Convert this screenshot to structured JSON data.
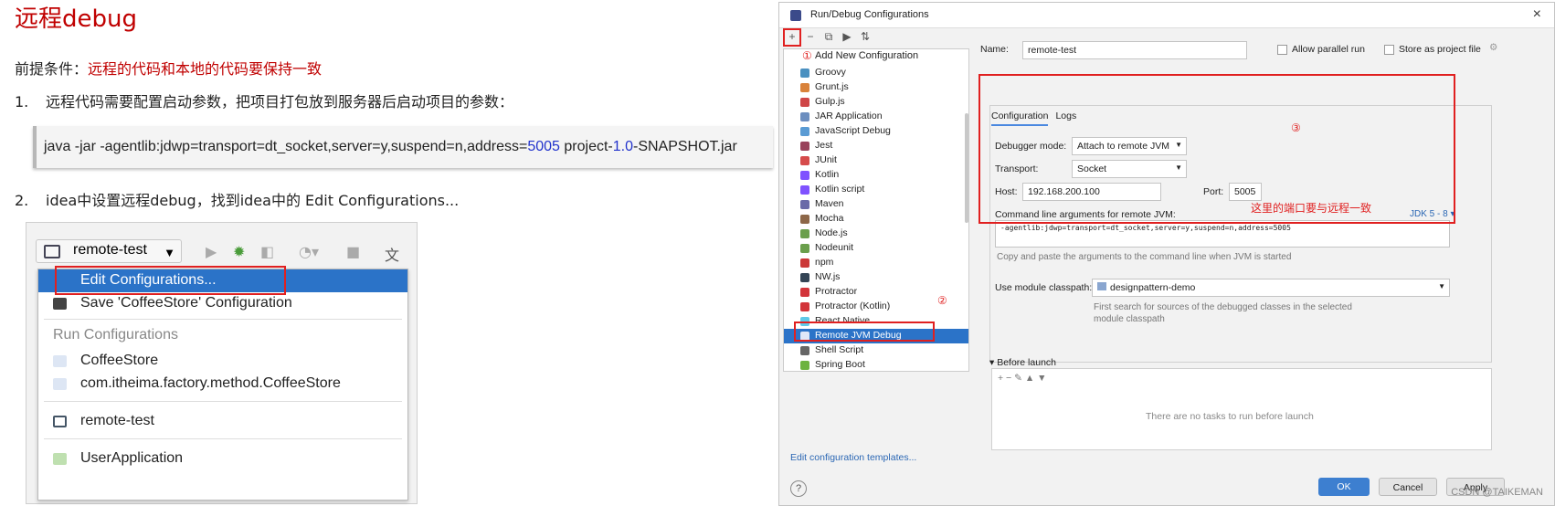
{
  "slide": {
    "title": "远程debug",
    "pre_label": "前提条件：",
    "pre_text": "远程的代码和本地的代码要保持一致",
    "step1_num": "1.",
    "step1_text": "远程代码需要配置启动参数，把项目打包放到服务器后启动项目的参数：",
    "code_a": "java -jar -agentlib:jdwp=transport=dt_socket,server=y,suspend=n,address=",
    "code_port": "5005",
    "code_b": " project-",
    "code_ver": "1.0",
    "code_c": "-SNAPSHOT.jar",
    "step2_num": "2.",
    "step2_text": "idea中设置远程debug，找到idea中的 Edit Configurations..."
  },
  "idea": {
    "run_config": "remote-test",
    "menu": {
      "edit": "Edit Configurations...",
      "save": "Save 'CoffeeStore' Configuration",
      "header": "Run Configurations",
      "items": [
        "CoffeeStore",
        "com.itheima.factory.method.CoffeeStore"
      ],
      "remote": "remote-test",
      "user_app": "UserApplication"
    }
  },
  "dialog": {
    "title": "Run/Debug Configurations",
    "close": "×",
    "toolbar": [
      "+",
      "−",
      "⧉",
      "▶",
      "⇅"
    ],
    "add_new": "Add New Configuration",
    "ann1": "①",
    "ann2": "②",
    "ann3": "③",
    "ann_text": "这里的端口要与远程一致",
    "templates": [
      {
        "label": "Groovy",
        "color": "#4a90c0"
      },
      {
        "label": "Grunt.js",
        "color": "#d9823a"
      },
      {
        "label": "Gulp.js",
        "color": "#cf4647"
      },
      {
        "label": "JAR Application",
        "color": "#6c8ebf"
      },
      {
        "label": "JavaScript Debug",
        "color": "#5a9bd4"
      },
      {
        "label": "Jest",
        "color": "#99425b"
      },
      {
        "label": "JUnit",
        "color": "#d64b4b"
      },
      {
        "label": "Kotlin",
        "color": "#7f52ff"
      },
      {
        "label": "Kotlin script",
        "color": "#7f52ff"
      },
      {
        "label": "Maven",
        "color": "#6a6aa8"
      },
      {
        "label": "Mocha",
        "color": "#8d6748"
      },
      {
        "label": "Node.js",
        "color": "#6a9f4c"
      },
      {
        "label": "Nodeunit",
        "color": "#6a9f4c"
      },
      {
        "label": "npm",
        "color": "#cb3837"
      },
      {
        "label": "NW.js",
        "color": "#334455"
      },
      {
        "label": "Protractor",
        "color": "#d2343a"
      },
      {
        "label": "Protractor (Kotlin)",
        "color": "#d2343a"
      },
      {
        "label": "React Native",
        "color": "#5fc9e8"
      },
      {
        "label": "Remote JVM Debug",
        "color": "#e0e8f8"
      },
      {
        "label": "Shell Script",
        "color": "#666666"
      },
      {
        "label": "Spring Boot",
        "color": "#6db33f"
      }
    ],
    "edit_templates": "Edit configuration templates...",
    "help": "?",
    "name_label": "Name:",
    "name_value": "remote-test",
    "allow_parallel": "Allow parallel run",
    "store_project": "Store as project file",
    "tab_config": "Configuration",
    "tab_logs": "Logs",
    "debugger_mode_label": "Debugger mode:",
    "debugger_mode": "Attach to remote JVM",
    "transport_label": "Transport:",
    "transport": "Socket",
    "host_label": "Host:",
    "host": "192.168.200.100",
    "port_label": "Port:",
    "port": "5005",
    "cmd_label": "Command line arguments for remote JVM:",
    "jdk": "JDK 5 - 8 ▾",
    "cmd_value": "-agentlib:jdwp=transport=dt_socket,server=y,suspend=n,address=5005",
    "cmd_hint": "Copy and paste the arguments to the command line when JVM is started",
    "classpath_label": "Use module classpath:",
    "classpath": "designpattern-demo",
    "classpath_hint": "First search for sources of the debugged classes in the selected",
    "classpath_hint2": "module classpath",
    "before_launch": "Before launch",
    "no_tasks": "There are no tasks to run before launch",
    "ok": "OK",
    "cancel": "Cancel",
    "apply": "Apply",
    "watermark": "CSDN @TAIKEMAN"
  }
}
